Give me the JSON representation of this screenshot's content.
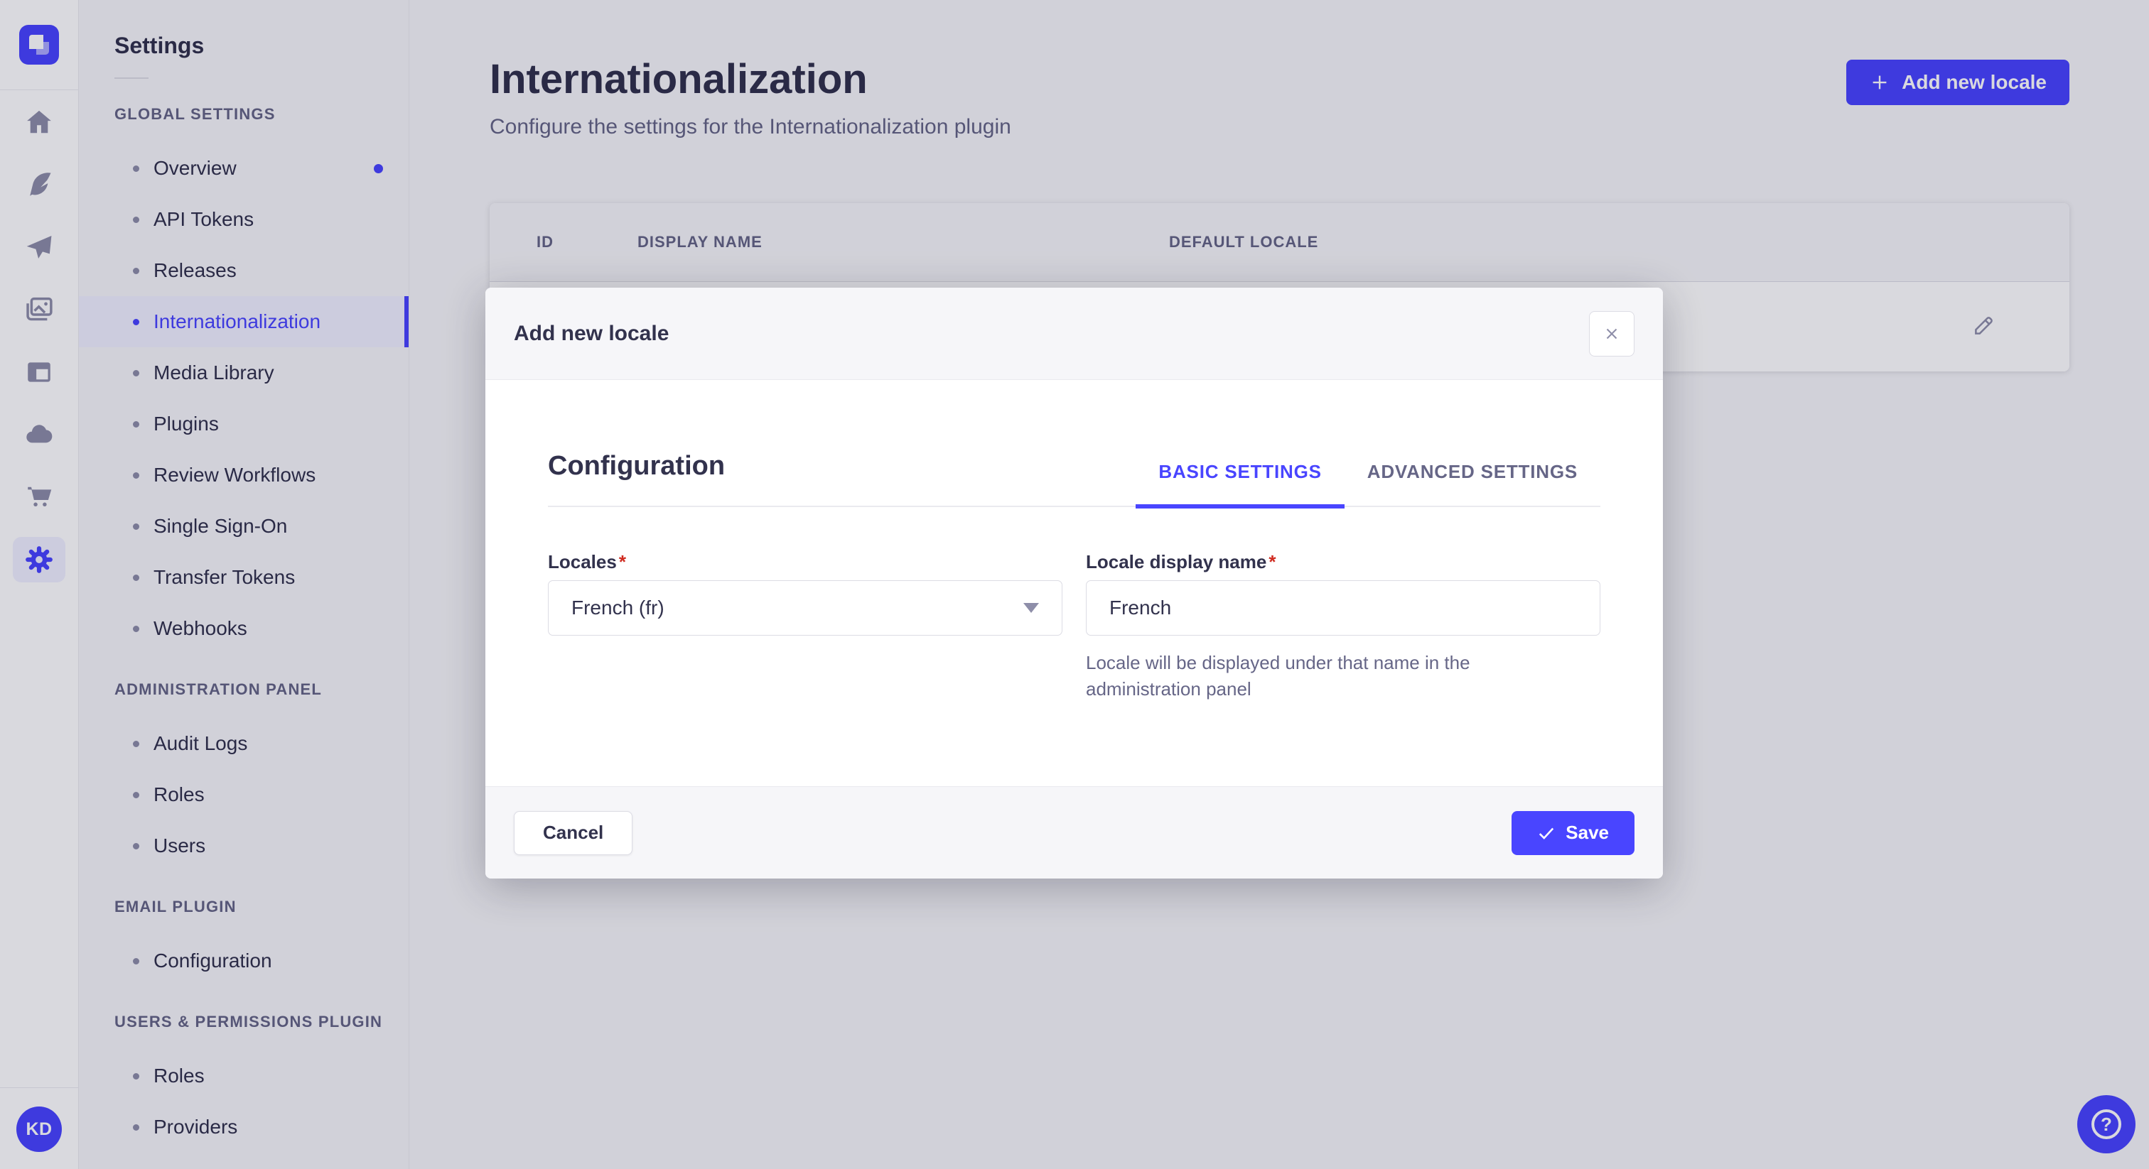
{
  "colors": {
    "primary": "#4945ff",
    "primary_light": "#f0f0ff",
    "text_dark": "#32324d",
    "text_muted": "#666687",
    "border": "#dcdce4",
    "divider": "#eaeaef",
    "page_bg": "#f6f6f9",
    "icon_gray": "#8e8ea9",
    "required_red": "#d02b20"
  },
  "rail": {
    "logo_icon": "strapi-logo",
    "icons": [
      "home-icon",
      "feather-icon",
      "paper-plane-icon",
      "media-library-icon",
      "layout-icon",
      "cloud-icon",
      "cart-icon",
      "settings-gear-icon"
    ],
    "active_icon": "settings-gear-icon",
    "avatar_initials": "KD"
  },
  "subnav": {
    "title": "Settings",
    "sections": [
      {
        "label": "GLOBAL SETTINGS",
        "items": [
          {
            "label": "Overview",
            "badge": true
          },
          {
            "label": "API Tokens"
          },
          {
            "label": "Releases"
          },
          {
            "label": "Internationalization",
            "active": true
          },
          {
            "label": "Media Library"
          },
          {
            "label": "Plugins"
          },
          {
            "label": "Review Workflows"
          },
          {
            "label": "Single Sign-On"
          },
          {
            "label": "Transfer Tokens"
          },
          {
            "label": "Webhooks"
          }
        ]
      },
      {
        "label": "ADMINISTRATION PANEL",
        "items": [
          {
            "label": "Audit Logs"
          },
          {
            "label": "Roles"
          },
          {
            "label": "Users"
          }
        ]
      },
      {
        "label": "EMAIL PLUGIN",
        "items": [
          {
            "label": "Configuration"
          }
        ]
      },
      {
        "label": "USERS & PERMISSIONS PLUGIN",
        "items": [
          {
            "label": "Roles"
          },
          {
            "label": "Providers"
          }
        ]
      }
    ]
  },
  "header": {
    "title": "Internationalization",
    "subtitle": "Configure the settings for the Internationalization plugin",
    "add_button_label": "Add new locale",
    "add_button_icon": "plus-icon"
  },
  "table": {
    "columns": [
      "ID",
      "DISPLAY NAME",
      "DEFAULT LOCALE"
    ],
    "row_action_icon": "pencil-icon"
  },
  "modal": {
    "title": "Add new locale",
    "close_icon": "x-icon",
    "section_title": "Configuration",
    "tabs": [
      {
        "label": "BASIC SETTINGS",
        "active": true
      },
      {
        "label": "ADVANCED SETTINGS",
        "active": false
      }
    ],
    "fields": {
      "locales": {
        "label": "Locales",
        "required": "*",
        "value": "French (fr)",
        "control": "select",
        "caret_icon": "chevron-down-icon"
      },
      "display_name": {
        "label": "Locale display name",
        "required": "*",
        "value": "French",
        "hint": "Locale will be displayed under that name in the administration panel"
      }
    },
    "footer": {
      "cancel_label": "Cancel",
      "save_label": "Save",
      "save_icon": "check-icon"
    }
  },
  "help": {
    "icon": "question-mark-icon",
    "glyph": "?"
  }
}
